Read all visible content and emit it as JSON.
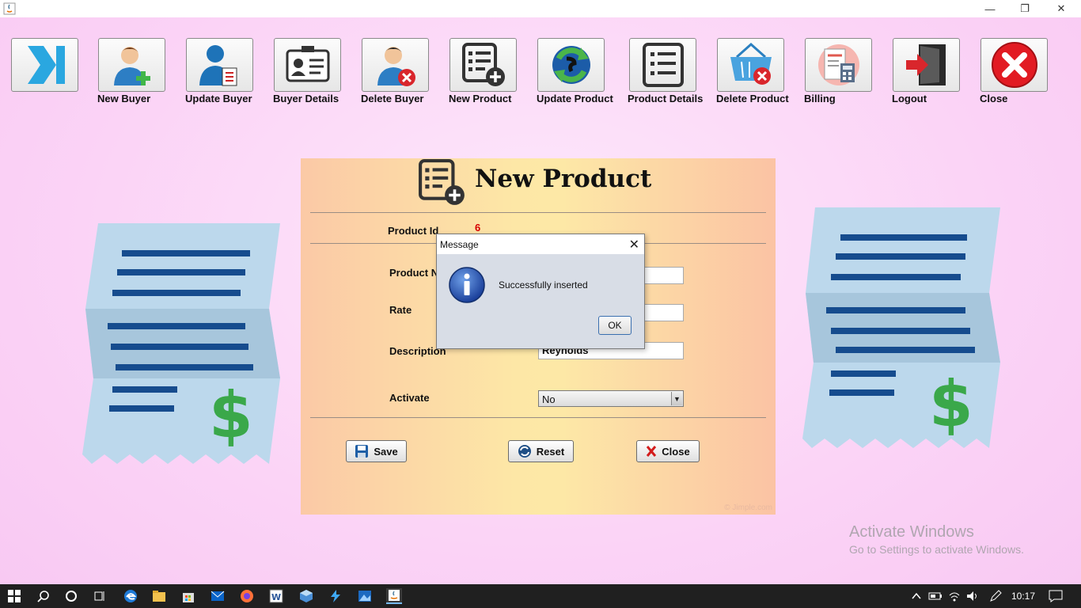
{
  "window": {
    "min": "—",
    "max": "❐",
    "close": "✕"
  },
  "toolbar": [
    {
      "label": ""
    },
    {
      "label": "New Buyer"
    },
    {
      "label": "Update Buyer"
    },
    {
      "label": "Buyer Details"
    },
    {
      "label": "Delete Buyer"
    },
    {
      "label": "New Product"
    },
    {
      "label": "Update Product"
    },
    {
      "label": "Product Details"
    },
    {
      "label": "Delete Product"
    },
    {
      "label": "Billing"
    },
    {
      "label": "Logout"
    },
    {
      "label": "Close"
    }
  ],
  "form": {
    "title": "New Product",
    "product_id_label": "Product Id",
    "product_id_value": "6",
    "product_name_label": "Product N",
    "product_name_value": "",
    "rate_label": "Rate",
    "rate_value": "",
    "description_label": "Description",
    "description_value": "Reynolds",
    "activate_label": "Activate",
    "activate_value": "No",
    "save_label": "Save",
    "reset_label": "Reset",
    "close_label": "Close",
    "watermark": "© Jimple.com"
  },
  "dialog": {
    "title": "Message",
    "message": "Successfully inserted",
    "ok_label": "OK"
  },
  "activation": {
    "line1": "Activate Windows",
    "line2": "Go to Settings to activate Windows."
  },
  "taskbar": {
    "clock": "10:17"
  }
}
